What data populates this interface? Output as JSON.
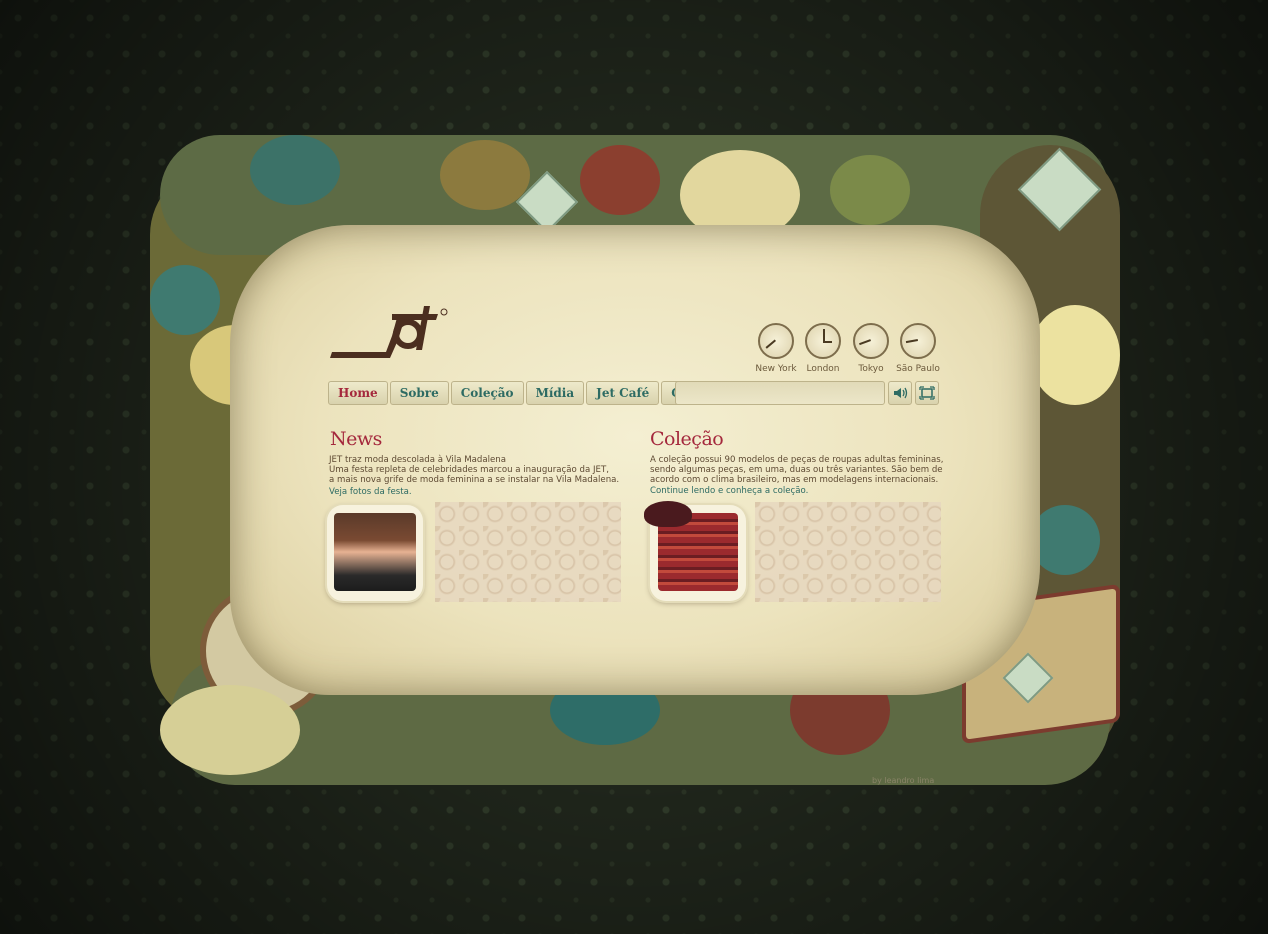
{
  "brand": {
    "logo_text": "jet"
  },
  "clocks": [
    {
      "city": "New York"
    },
    {
      "city": "London"
    },
    {
      "city": "Tokyo"
    },
    {
      "city": "São Paulo"
    }
  ],
  "nav": {
    "items": [
      {
        "label": "Home"
      },
      {
        "label": "Sobre"
      },
      {
        "label": "Coleção"
      },
      {
        "label": "Mídia"
      },
      {
        "label": "Jet Café"
      },
      {
        "label": "Contato"
      }
    ],
    "active": "Home",
    "icons": [
      "speaker-icon",
      "fullscreen-icon"
    ]
  },
  "news": {
    "title": "News",
    "lines": [
      "JET traz moda descolada à Vila Madalena",
      "Uma festa repleta de celebridades marcou a inauguração da JET,",
      "a mais nova grife de moda feminina a se instalar na Vila Madalena."
    ],
    "link": "Veja fotos da festa."
  },
  "colecao": {
    "title": "Coleção",
    "lines": [
      "A coleção possui 90 modelos de peças de roupas adultas femininas,",
      "sendo algumas peças, em uma, duas ou três variantes. São bem de",
      "acordo com o clima brasileiro, mas em modelagens internacionais."
    ],
    "link": "Continue lendo e conheça a coleção."
  },
  "credit": "by leandro lima",
  "colors": {
    "accent_red": "#a4283c",
    "accent_teal": "#2d6b63",
    "paper": "#efe7c6",
    "background": "#1f251b"
  }
}
